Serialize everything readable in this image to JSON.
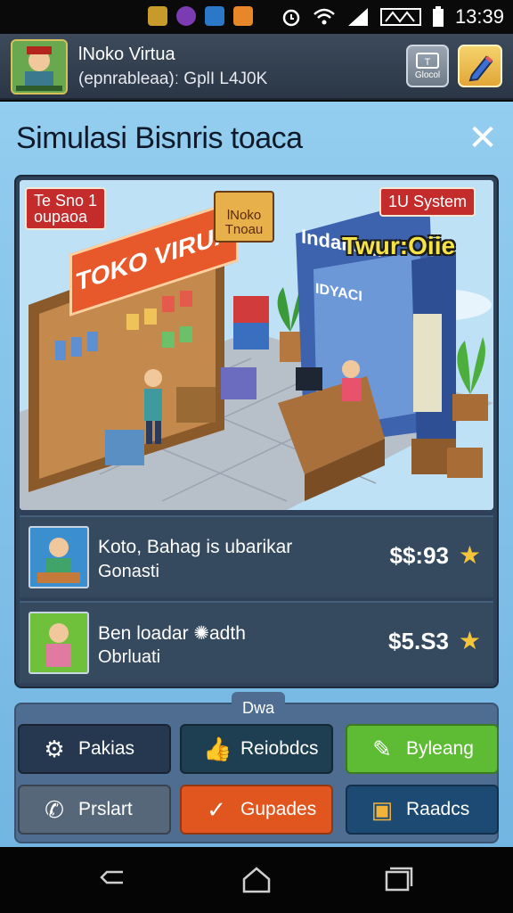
{
  "status_bar": {
    "time": "13:39",
    "icons": [
      "notification-icon",
      "app-icon",
      "shield-icon",
      "game-icon",
      "alarm-icon",
      "wifi-icon",
      "signal-icon",
      "battery-icon"
    ],
    "colors": {
      "app1": "#c79a2b",
      "app2": "#7b3bb3",
      "app3": "#2b78c8",
      "app4": "#e8862a"
    }
  },
  "header": {
    "title": "lNoko Virtua",
    "subtitle": "(epnrableaa)ː GplI L4J0K",
    "btn1_label": "Glocol",
    "btn2_icon": "pencil-icon"
  },
  "dialog": {
    "title": "Simulasi Bisnris toaca",
    "close": "✕",
    "scene": {
      "tag_left": "Te Sno 1\noupaoa",
      "tag_right": "1U System",
      "sign_main": "TOKO VIRUA",
      "sign_small": "lNoko\nTnoau",
      "shop_sign": "Indansia",
      "shop_sub": "IDYACI",
      "banner": "Twur:Oiie"
    },
    "rows": [
      {
        "line1": "Koto, Bahag is ubarikar",
        "line2": "Gonasti",
        "price": "$$:93",
        "thumb_color": "#3b8fcf"
      },
      {
        "line1": "Ben loadar ✺adth",
        "line2": "Obrluati",
        "price": "$5.S3",
        "thumb_color": "#6fc03a"
      }
    ],
    "actions": {
      "caption": "Dwa",
      "buttons": [
        {
          "label": "Pakias",
          "icon": "⚙",
          "color": "#26384f"
        },
        {
          "label": "Reiobdcs",
          "icon": "👍",
          "color": "#1e3e52"
        },
        {
          "label": "Byleang",
          "icon": "✎",
          "color": "#5dbb34"
        },
        {
          "label": "Prslart",
          "icon": "✆",
          "color": "#56677a"
        },
        {
          "label": "Gupades",
          "icon": "✓",
          "color": "#e0561e"
        },
        {
          "label": "Raadcs",
          "icon": "▣",
          "color": "#1d4a73"
        }
      ]
    }
  }
}
